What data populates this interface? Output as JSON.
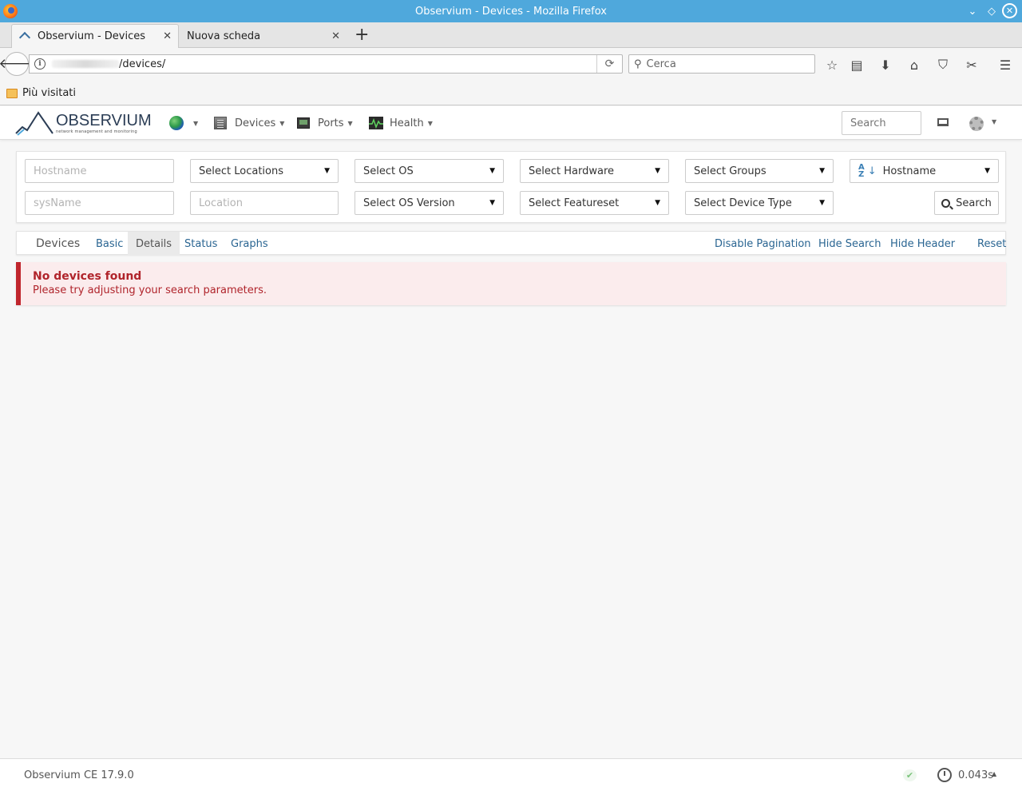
{
  "window": {
    "title": "Observium - Devices - Mozilla Firefox"
  },
  "tabs": [
    {
      "label": "Observium - Devices",
      "active": true
    },
    {
      "label": "Nuova scheda",
      "active": false
    }
  ],
  "navbar": {
    "url_path": "/devices/",
    "search_placeholder": "Cerca"
  },
  "bookmarks": {
    "folder_label": "Più visitati"
  },
  "app": {
    "logo_text": "OBSERVIUM",
    "logo_tagline": "network management and monitoring",
    "menu": {
      "devices": "Devices",
      "ports": "Ports",
      "health": "Health"
    },
    "search_placeholder": "Search"
  },
  "filters": {
    "hostname_placeholder": "Hostname",
    "sysname_placeholder": "sysName",
    "location_placeholder": "Location",
    "select_locations": "Select Locations",
    "select_os": "Select OS",
    "select_hardware": "Select Hardware",
    "select_groups": "Select Groups",
    "sort_by": "Hostname",
    "select_os_version": "Select OS Version",
    "select_featureset": "Select Featureset",
    "select_device_type": "Select Device Type",
    "search_button": "Search"
  },
  "subnav": {
    "brand": "Devices",
    "views": [
      "Basic",
      "Details",
      "Status",
      "Graphs"
    ],
    "active_view": "Details",
    "actions": [
      "Disable Pagination",
      "Hide Search",
      "Hide Header",
      "Reset"
    ]
  },
  "alert": {
    "title": "No devices found",
    "message": "Please try adjusting your search parameters."
  },
  "footer": {
    "version": "Observium CE 17.9.0",
    "runtime": "0.043s"
  },
  "colors": {
    "titlebar": "#4fa8dc",
    "link": "#2a6592",
    "alert_red": "#c0262d",
    "alert_bg": "#fbeced"
  }
}
